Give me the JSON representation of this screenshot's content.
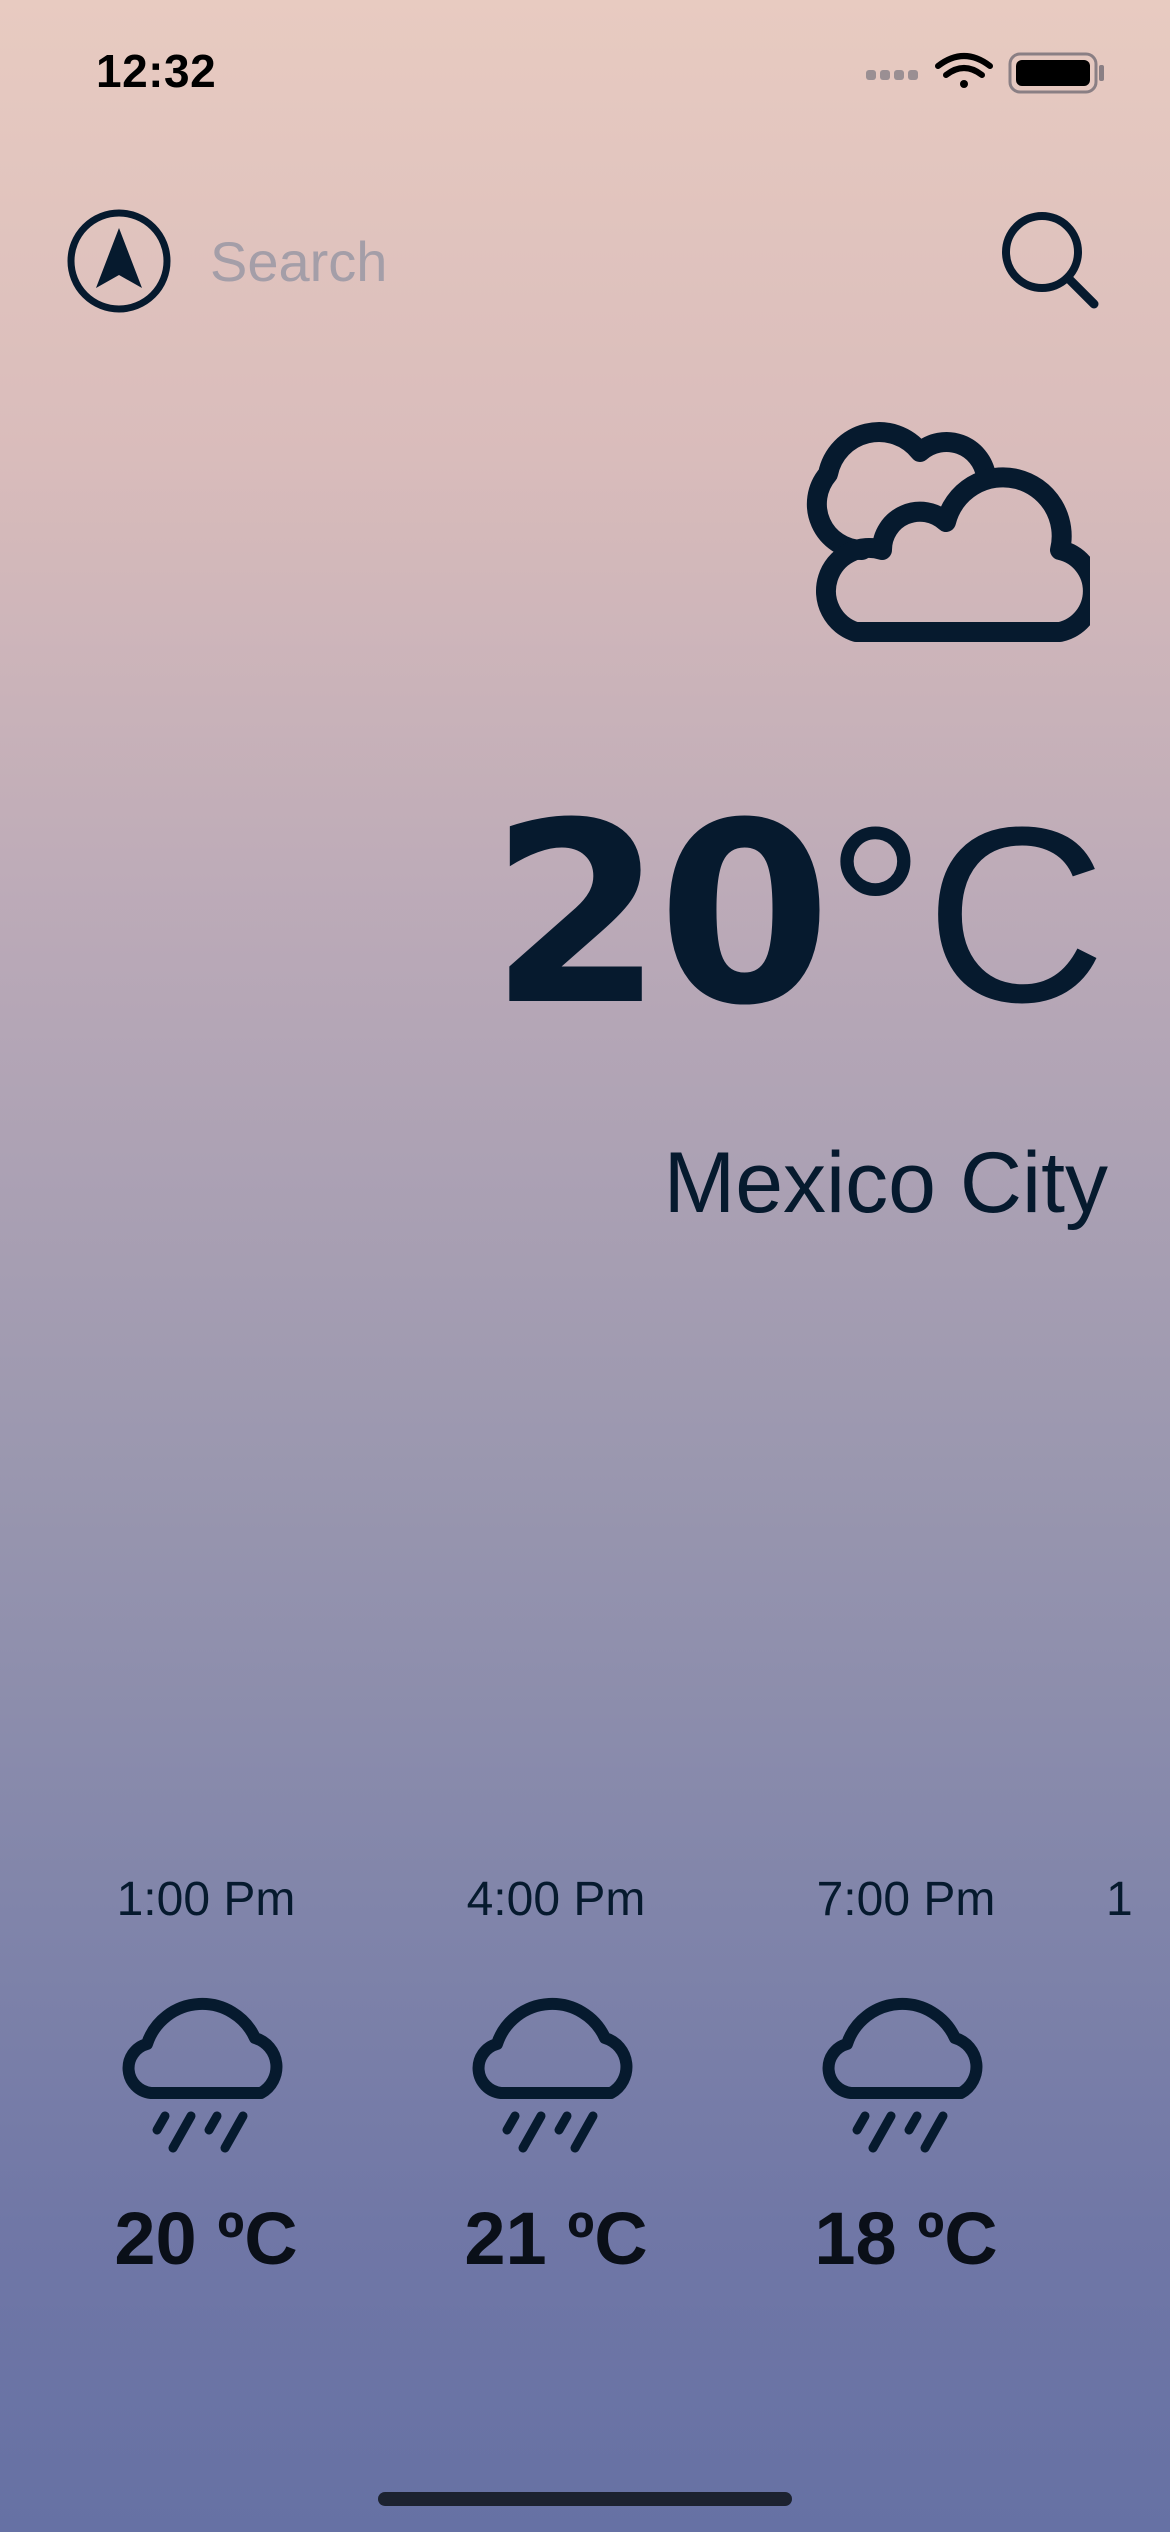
{
  "status_bar": {
    "time": "12:32",
    "signal_icon": "cellular-dots-icon",
    "wifi_icon": "wifi-icon",
    "battery_icon": "battery-icon"
  },
  "search": {
    "location_icon": "location-arrow-icon",
    "placeholder": "Search",
    "value": "",
    "search_icon": "magnifier-icon"
  },
  "current": {
    "condition_icon": "cloudy-icon",
    "temperature": "20",
    "unit": "°C",
    "city": "Mexico City"
  },
  "forecast": [
    {
      "time": "1:00 Pm",
      "icon": "rain-cloud-icon",
      "temp": "20 ºC"
    },
    {
      "time": "4:00 Pm",
      "icon": "rain-cloud-icon",
      "temp": "21 ºC"
    },
    {
      "time": "7:00 Pm",
      "icon": "rain-cloud-icon",
      "temp": "18 ºC"
    },
    {
      "time": "1",
      "icon": "",
      "temp": ""
    }
  ],
  "colors": {
    "text_dark": "#061a2e",
    "placeholder": "#a49ea8",
    "gradient_top": "#e8cbc1",
    "gradient_bottom": "#6671a4"
  }
}
